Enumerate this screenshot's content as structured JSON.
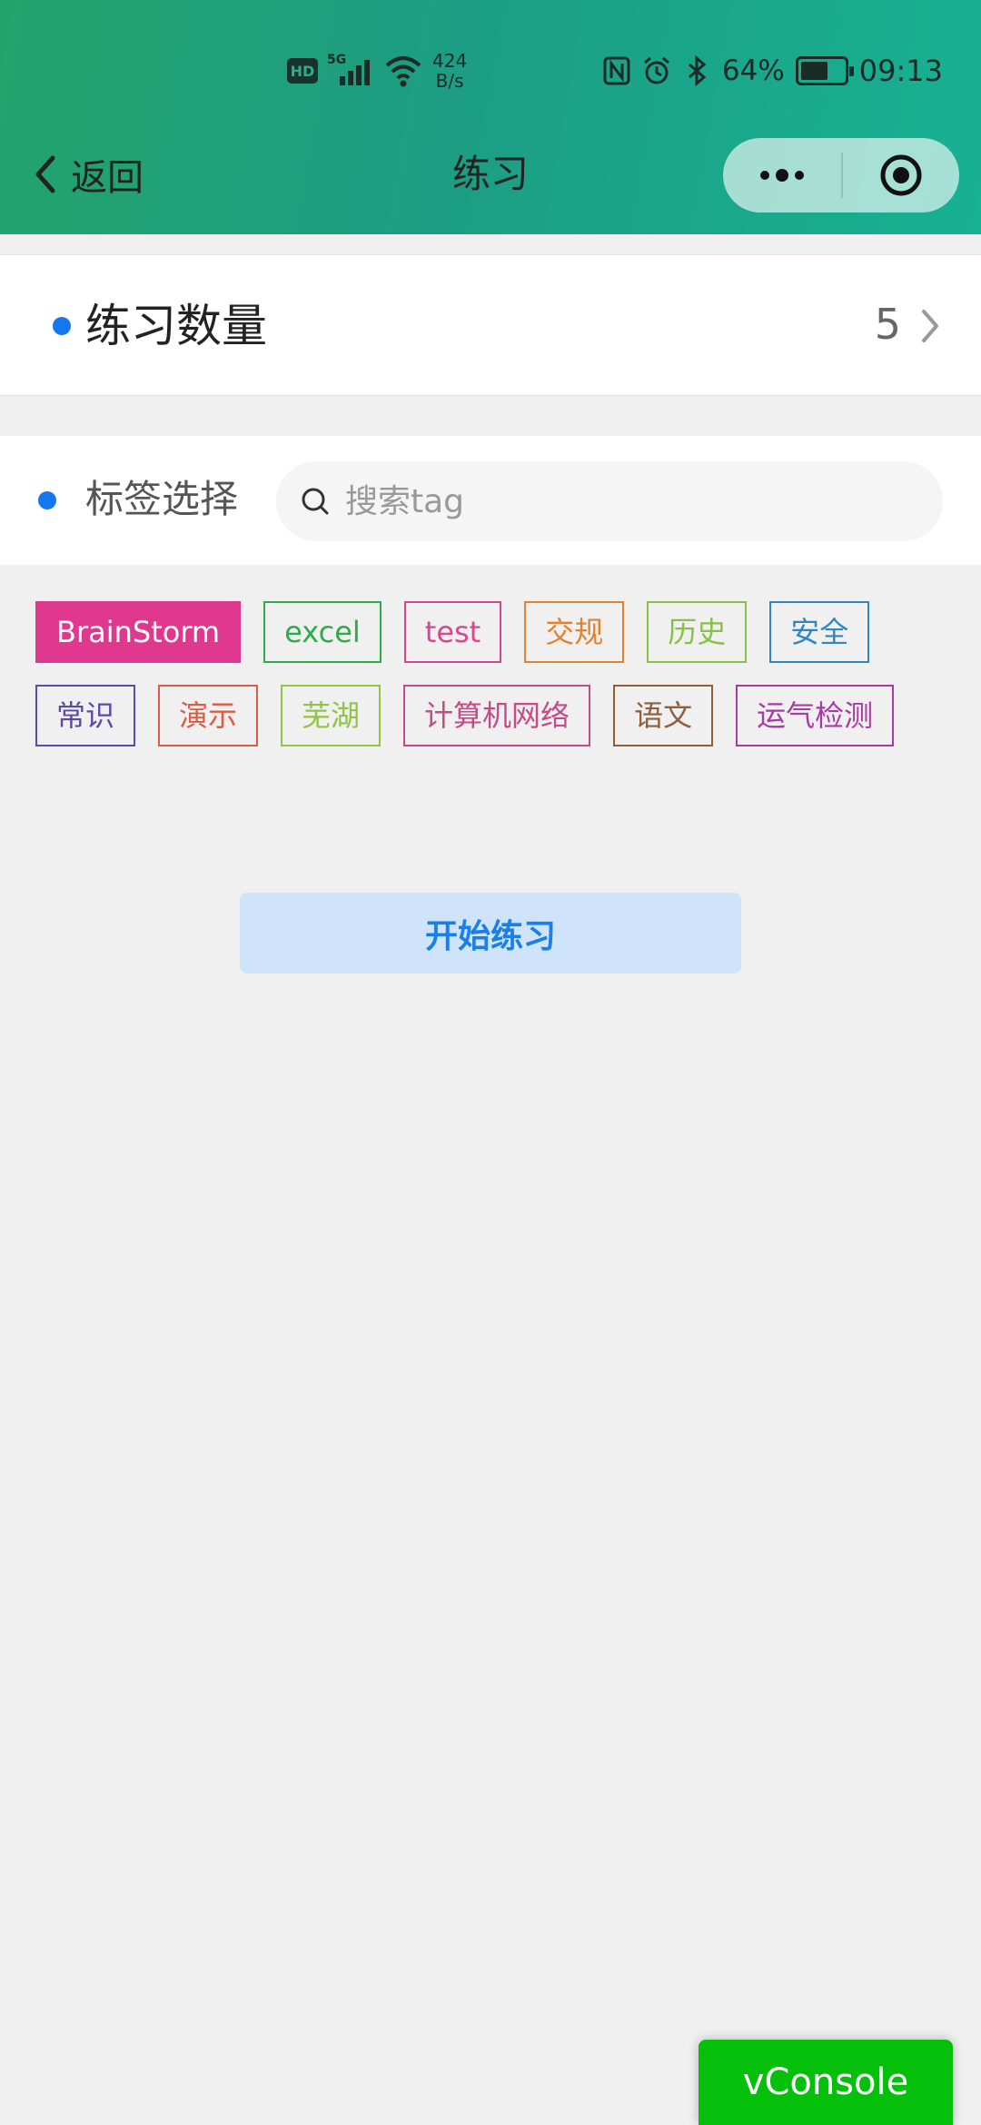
{
  "status_bar": {
    "hd_badge": "HD",
    "network": "5G",
    "speed_value": "424",
    "speed_unit": "B/s",
    "battery_percent": "64%",
    "battery_level": 0.64,
    "time": "09:13",
    "icons": [
      "hd-icon",
      "signal-icon",
      "wifi-icon",
      "nfc-icon",
      "alarm-icon",
      "bluetooth-icon",
      "battery-icon"
    ]
  },
  "navbar": {
    "back_label": "返回",
    "title": "练习",
    "icons": [
      "chevron-left-icon",
      "more-icon",
      "target-close-icon"
    ]
  },
  "count_row": {
    "label": "练习数量",
    "value": "5"
  },
  "tag_select": {
    "label": "标签选择",
    "search_placeholder": "搜索tag",
    "search_value": ""
  },
  "tags": [
    {
      "label": "BrainStorm",
      "color": "#e0388f",
      "selected": true
    },
    {
      "label": "excel",
      "color": "#2fab4a",
      "selected": false
    },
    {
      "label": "test",
      "color": "#d6478f",
      "selected": false
    },
    {
      "label": "交规",
      "color": "#e4812e",
      "selected": false
    },
    {
      "label": "历史",
      "color": "#86c243",
      "selected": false
    },
    {
      "label": "安全",
      "color": "#2e86c4",
      "selected": false
    },
    {
      "label": "常识",
      "color": "#5c4aa8",
      "selected": false
    },
    {
      "label": "演示",
      "color": "#df5a43",
      "selected": false
    },
    {
      "label": "芜湖",
      "color": "#8fc444",
      "selected": false
    },
    {
      "label": "计算机网络",
      "color": "#c54a86",
      "selected": false
    },
    {
      "label": "语文",
      "color": "#8f5f3b",
      "selected": false
    },
    {
      "label": "运气检测",
      "color": "#a93aa3",
      "selected": false
    }
  ],
  "start_button": {
    "label": "开始练习"
  },
  "vconsole": {
    "label": "vConsole"
  },
  "colors": {
    "accent_blue": "#1477ef",
    "header_gradient": [
      "#23a36c",
      "#17b193"
    ],
    "vconsole_green": "#05c00a",
    "start_btn_bg": "#cfe4fb"
  }
}
